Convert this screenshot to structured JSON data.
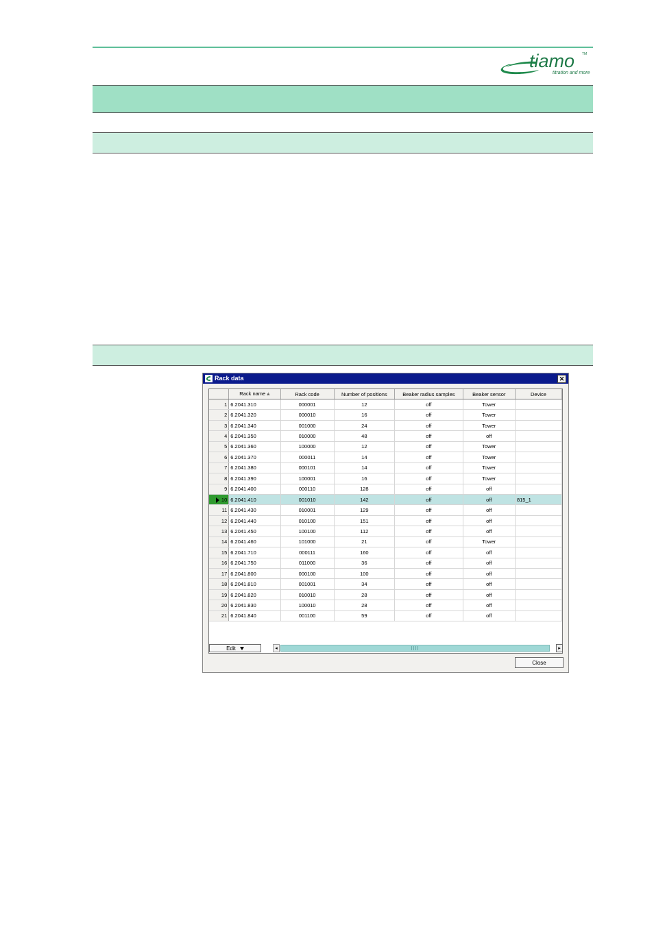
{
  "header": {
    "logo_text": "tiamo",
    "logo_tm": "TM",
    "logo_tagline": "titration and more"
  },
  "dialog": {
    "title": "Rack data",
    "close_glyph": "✕",
    "columns": [
      "",
      "Rack name ⩓",
      "Rack code",
      "Number of positions",
      "Beaker radius samples",
      "Beaker sensor",
      "Device"
    ],
    "selected_row": 10,
    "rows": [
      {
        "n": "1",
        "name": "6.2041.310",
        "code": "000001",
        "positions": "12",
        "radius": "off",
        "sensor": "Tower",
        "device": ""
      },
      {
        "n": "2",
        "name": "6.2041.320",
        "code": "000010",
        "positions": "16",
        "radius": "off",
        "sensor": "Tower",
        "device": ""
      },
      {
        "n": "3",
        "name": "6.2041.340",
        "code": "001000",
        "positions": "24",
        "radius": "off",
        "sensor": "Tower",
        "device": ""
      },
      {
        "n": "4",
        "name": "6.2041.350",
        "code": "010000",
        "positions": "48",
        "radius": "off",
        "sensor": "off",
        "device": ""
      },
      {
        "n": "5",
        "name": "6.2041.360",
        "code": "100000",
        "positions": "12",
        "radius": "off",
        "sensor": "Tower",
        "device": ""
      },
      {
        "n": "6",
        "name": "6.2041.370",
        "code": "000011",
        "positions": "14",
        "radius": "off",
        "sensor": "Tower",
        "device": ""
      },
      {
        "n": "7",
        "name": "6.2041.380",
        "code": "000101",
        "positions": "14",
        "radius": "off",
        "sensor": "Tower",
        "device": ""
      },
      {
        "n": "8",
        "name": "6.2041.390",
        "code": "100001",
        "positions": "16",
        "radius": "off",
        "sensor": "Tower",
        "device": ""
      },
      {
        "n": "9",
        "name": "6.2041.400",
        "code": "000110",
        "positions": "128",
        "radius": "off",
        "sensor": "off",
        "device": ""
      },
      {
        "n": "10",
        "name": "6.2041.410",
        "code": "001010",
        "positions": "142",
        "radius": "off",
        "sensor": "off",
        "device": "815_1"
      },
      {
        "n": "11",
        "name": "6.2041.430",
        "code": "010001",
        "positions": "129",
        "radius": "off",
        "sensor": "off",
        "device": ""
      },
      {
        "n": "12",
        "name": "6.2041.440",
        "code": "010100",
        "positions": "151",
        "radius": "off",
        "sensor": "off",
        "device": ""
      },
      {
        "n": "13",
        "name": "6.2041.450",
        "code": "100100",
        "positions": "112",
        "radius": "off",
        "sensor": "off",
        "device": ""
      },
      {
        "n": "14",
        "name": "6.2041.460",
        "code": "101000",
        "positions": "21",
        "radius": "off",
        "sensor": "Tower",
        "device": ""
      },
      {
        "n": "15",
        "name": "6.2041.710",
        "code": "000111",
        "positions": "160",
        "radius": "off",
        "sensor": "off",
        "device": ""
      },
      {
        "n": "16",
        "name": "6.2041.750",
        "code": "011000",
        "positions": "36",
        "radius": "off",
        "sensor": "off",
        "device": ""
      },
      {
        "n": "17",
        "name": "6.2041.800",
        "code": "000100",
        "positions": "100",
        "radius": "off",
        "sensor": "off",
        "device": ""
      },
      {
        "n": "18",
        "name": "6.2041.810",
        "code": "001001",
        "positions": "34",
        "radius": "off",
        "sensor": "off",
        "device": ""
      },
      {
        "n": "19",
        "name": "6.2041.820",
        "code": "010010",
        "positions": "28",
        "radius": "off",
        "sensor": "off",
        "device": ""
      },
      {
        "n": "20",
        "name": "6.2041.830",
        "code": "100010",
        "positions": "28",
        "radius": "off",
        "sensor": "off",
        "device": ""
      },
      {
        "n": "21",
        "name": "6.2041.840",
        "code": "001100",
        "positions": "59",
        "radius": "off",
        "sensor": "off",
        "device": ""
      }
    ],
    "edit_label": "Edit",
    "close_label": "Close",
    "scroll_left_glyph": "◂",
    "scroll_right_glyph": "▸"
  },
  "colors": {
    "brand_green": "#1f8a4c",
    "band_dark": "#9fe0c5",
    "band_light": "#cdeee0",
    "titlebar": "#0a1a8c",
    "selected_row": "#bfe3e3"
  }
}
